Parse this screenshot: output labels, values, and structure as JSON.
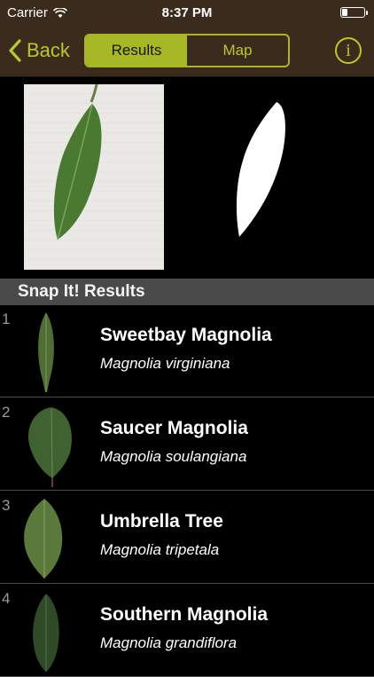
{
  "status_bar": {
    "carrier": "Carrier",
    "time": "8:37 PM"
  },
  "nav": {
    "back_label": "Back",
    "segments": [
      "Results",
      "Map"
    ],
    "selected_segment": "Results",
    "info_label": "i",
    "accent_color": "#a6b826"
  },
  "section_title": "Snap It! Results",
  "results": [
    {
      "rank": "1",
      "common_name": "Sweetbay Magnolia",
      "scientific_name": "Magnolia virginiana",
      "leaf_color": "#4f6e36"
    },
    {
      "rank": "2",
      "common_name": "Saucer Magnolia",
      "scientific_name": "Magnolia soulangiana",
      "leaf_color": "#3f6230"
    },
    {
      "rank": "3",
      "common_name": "Umbrella Tree",
      "scientific_name": "Magnolia tripetala",
      "leaf_color": "#5a7a3b"
    },
    {
      "rank": "4",
      "common_name": "Southern Magnolia",
      "scientific_name": "Magnolia grandiflora",
      "leaf_color": "#2f4a26"
    }
  ]
}
